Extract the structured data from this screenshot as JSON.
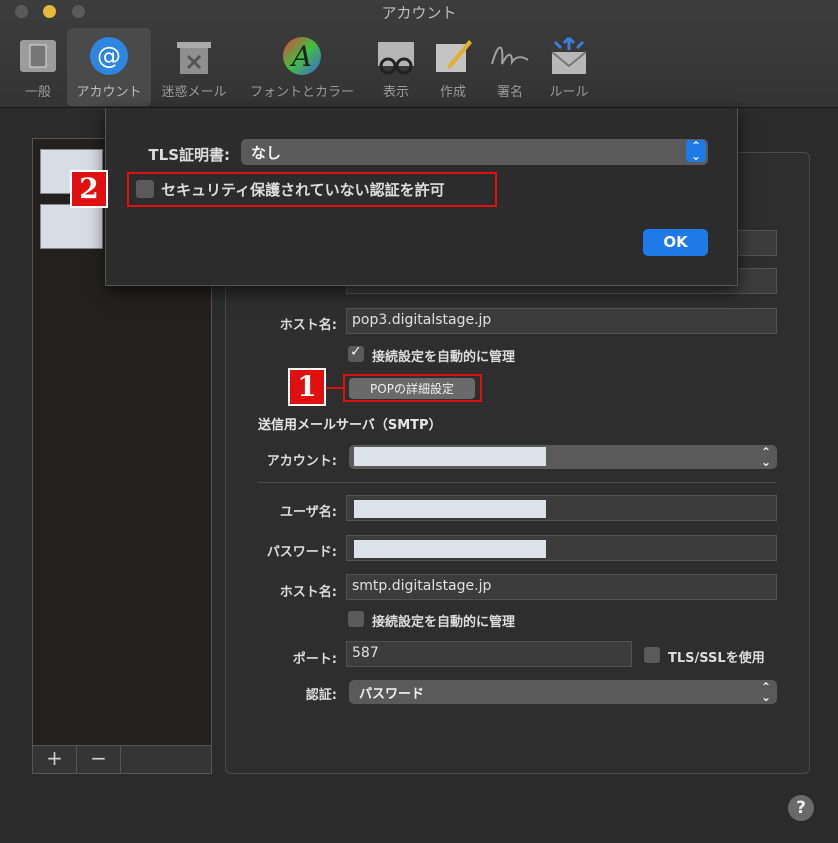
{
  "window": {
    "title": "アカウント"
  },
  "toolbar": [
    {
      "label": "一般",
      "icon": "general-switch-icon"
    },
    {
      "label": "アカウント",
      "icon": "at-sign-icon"
    },
    {
      "label": "迷惑メール",
      "icon": "junk-trash-icon"
    },
    {
      "label": "フォントとカラー",
      "icon": "font-color-icon"
    },
    {
      "label": "表示",
      "icon": "viewing-glasses-icon"
    },
    {
      "label": "作成",
      "icon": "compose-pencil-icon"
    },
    {
      "label": "署名",
      "icon": "signature-icon"
    },
    {
      "label": "ルール",
      "icon": "rules-envelope-icon"
    }
  ],
  "sheet": {
    "tls_label": "TLS証明書:",
    "tls_value": "なし",
    "insecure_auth_label": "セキュリティ保護されていない認証を許可",
    "insecure_auth_checked": false,
    "ok_label": "OK"
  },
  "incoming": {
    "host_label": "ホスト名:",
    "host_value": "pop3.digitalstage.jp",
    "auto_manage_label": "接続設定を自動的に管理",
    "auto_manage_checked": true,
    "advanced_button": "POPの詳細設定"
  },
  "outgoing": {
    "section_title": "送信用メールサーバ（SMTP）",
    "account_label": "アカウント:",
    "username_label": "ユーザ名:",
    "password_label": "パスワード:",
    "host_label": "ホスト名:",
    "host_value": "smtp.digitalstage.jp",
    "auto_manage_label": "接続設定を自動的に管理",
    "auto_manage_checked": false,
    "port_label": "ポート:",
    "port_value": "587",
    "tls_label": "TLS/SSLを使用",
    "tls_checked": false,
    "auth_label": "認証:",
    "auth_value": "パスワード"
  },
  "list_controls": {
    "add": "+",
    "remove": "−"
  },
  "annotations": {
    "badge1": "1",
    "badge2": "2"
  },
  "colors": {
    "accent": "#1e7ae6",
    "annotation": "#e01010"
  }
}
